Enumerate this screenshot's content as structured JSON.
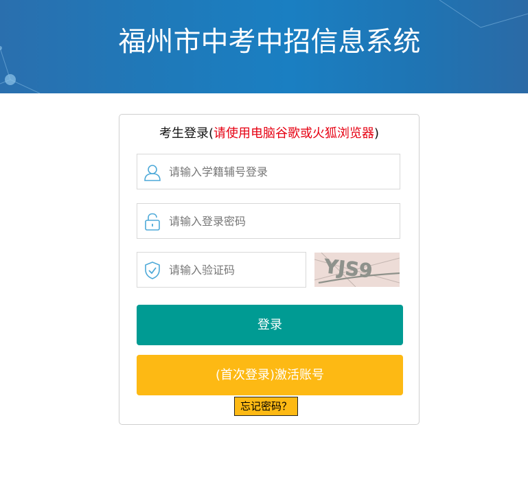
{
  "header": {
    "title": "福州市中考中招信息系统"
  },
  "login": {
    "title_prefix": "考生登录(",
    "title_warning": "请使用电脑谷歌或火狐浏览器",
    "title_suffix": ")",
    "username": {
      "placeholder": "请输入学籍辅号登录",
      "value": "",
      "icon": "user-icon"
    },
    "password": {
      "placeholder": "请输入登录密码",
      "value": "",
      "icon": "lock-icon"
    },
    "captcha_input": {
      "placeholder": "请输入验证码",
      "value": "",
      "icon": "shield-check-icon"
    },
    "captcha_image_text": "YJS9",
    "login_button": "登录",
    "activate_button": "(首次登录)激活账号",
    "forgot_link": "忘记密码？"
  },
  "colors": {
    "banner": "#1f79b9",
    "warning_text": "#e60012",
    "login_button": "#009b93",
    "activate_button": "#fdb914",
    "icon_stroke": "#4da9d8"
  }
}
